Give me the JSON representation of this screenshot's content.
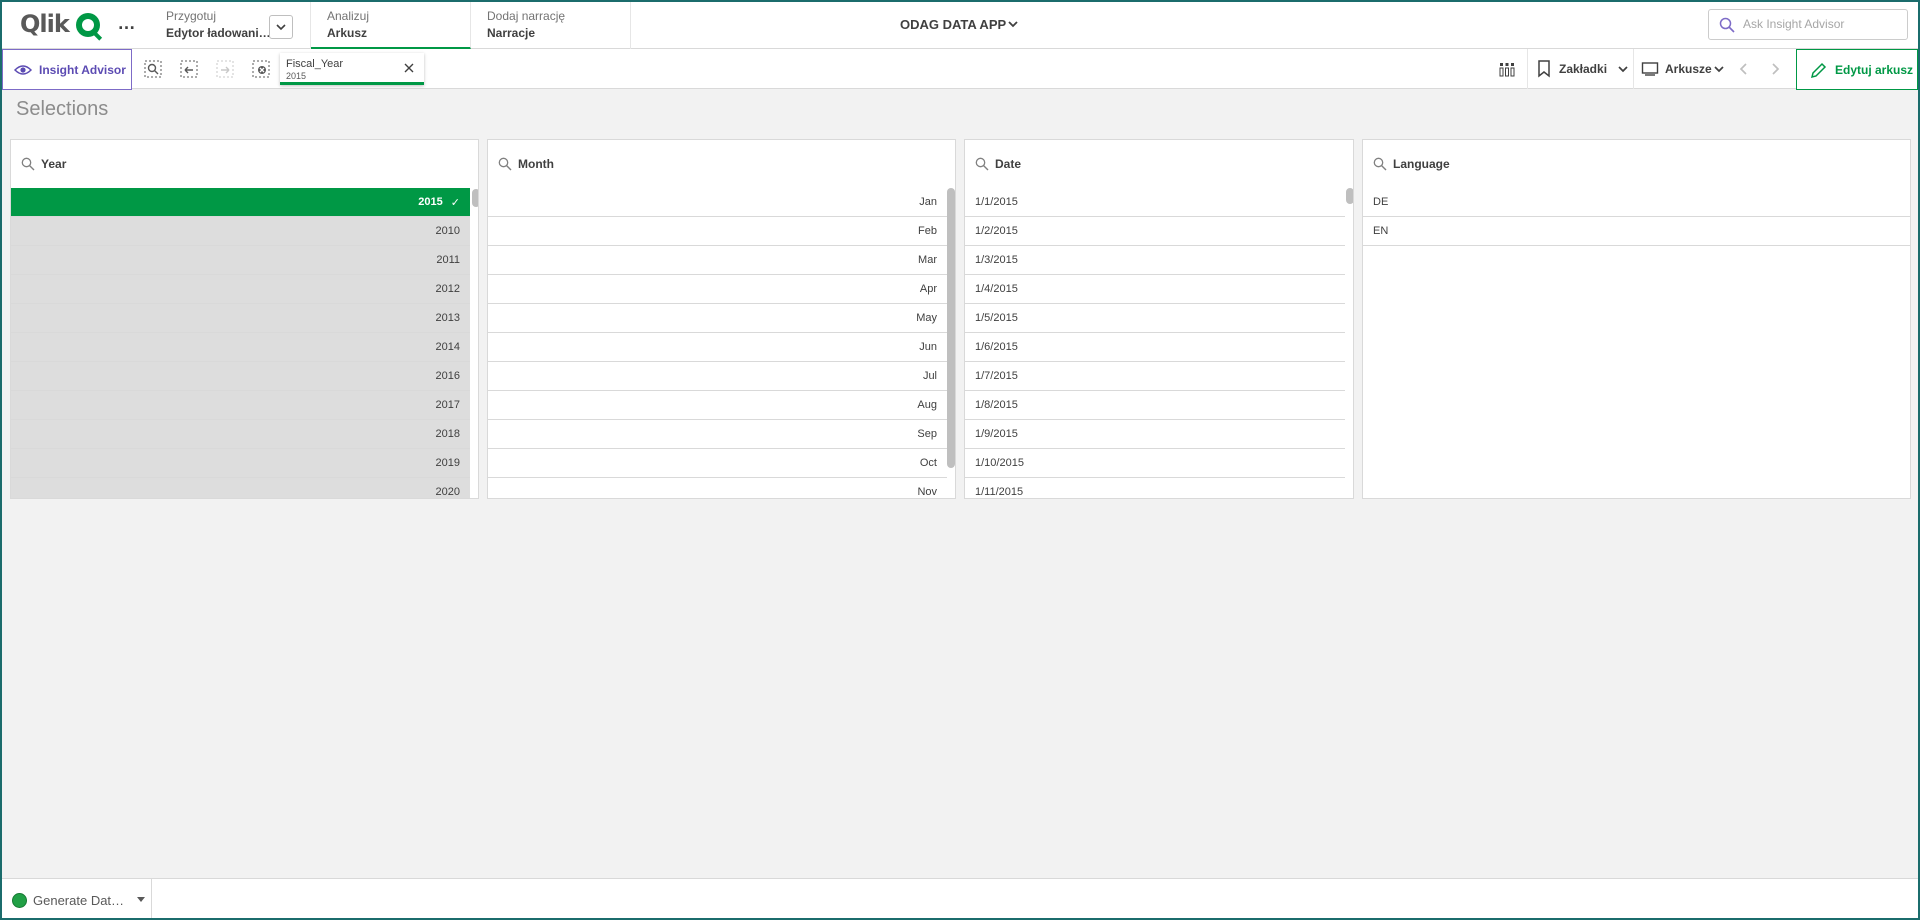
{
  "colors": {
    "accent": "#009845",
    "insight": "#5c4bb3",
    "excluded": "#dddddd"
  },
  "topbar": {
    "logo_text": "Qlik",
    "more_label": "…",
    "tabs": [
      {
        "small": "Przygotuj",
        "main": "Edytor ładowani…"
      },
      {
        "small": "Analizuj",
        "main": "Arkusz"
      },
      {
        "small": "Dodaj narrację",
        "main": "Narracje"
      }
    ],
    "app_title": "ODAG DATA APP",
    "search_placeholder": "Ask Insight Advisor"
  },
  "toolbar": {
    "insight_label": "Insight Advisor",
    "chip": {
      "field": "Fiscal_Year",
      "value": "2015"
    },
    "bookmarks_label": "Zakładki",
    "sheets_label": "Arkusze",
    "edit_label": "Edytuj arkusz"
  },
  "sheet": {
    "title": "Selections",
    "listboxes": [
      {
        "title": "Year",
        "selected": [
          "2015"
        ],
        "items": [
          "2015",
          "2010",
          "2011",
          "2012",
          "2013",
          "2014",
          "2016",
          "2017",
          "2018",
          "2019",
          "2020"
        ]
      },
      {
        "title": "Month",
        "items": [
          "Jan",
          "Feb",
          "Mar",
          "Apr",
          "May",
          "Jun",
          "Jul",
          "Aug",
          "Sep",
          "Oct",
          "Nov"
        ]
      },
      {
        "title": "Date",
        "items": [
          "1/1/2015",
          "1/2/2015",
          "1/3/2015",
          "1/4/2015",
          "1/5/2015",
          "1/6/2015",
          "1/7/2015",
          "1/8/2015",
          "1/9/2015",
          "1/10/2015",
          "1/11/2015"
        ]
      },
      {
        "title": "Language",
        "items": [
          "DE",
          "EN"
        ]
      }
    ]
  },
  "bottombar": {
    "label": "Generate Dat…"
  }
}
